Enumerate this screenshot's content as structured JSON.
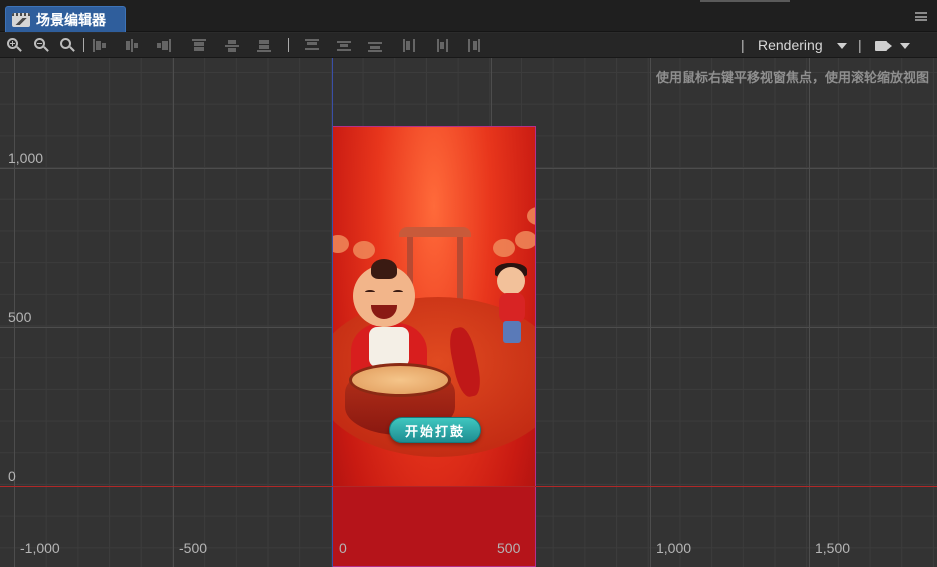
{
  "tab": {
    "title": "场景编辑器"
  },
  "toolbar": {
    "render_mode": "Rendering",
    "icons": [
      "zoom-in-icon",
      "zoom-out-icon",
      "zoom-reset-icon",
      "align-left-icon",
      "align-hcenter-icon",
      "align-right-icon",
      "align-top-icon",
      "align-vcenter-icon",
      "align-bottom-icon",
      "distribute-top-icon",
      "distribute-vcenter-icon",
      "distribute-bottom-icon",
      "distribute-left-icon",
      "distribute-hcenter-icon",
      "distribute-right-icon",
      "camera-icon"
    ]
  },
  "viewport": {
    "hint": "使用鼠标右键平移视窗焦点，使用滚轮缩放视图",
    "y_labels": [
      "1,000",
      "500",
      "0"
    ],
    "x_labels": [
      "-1,000",
      "-500",
      "0",
      "500",
      "1,000",
      "1,500"
    ]
  },
  "game": {
    "start_button": "开始打鼓"
  },
  "colors": {
    "tab_active": "#2f5e9c",
    "viewport_bg": "#333333",
    "x_axis": "#b02828",
    "y_axis": "#3a4fa8",
    "design_border": "#b3308c"
  }
}
